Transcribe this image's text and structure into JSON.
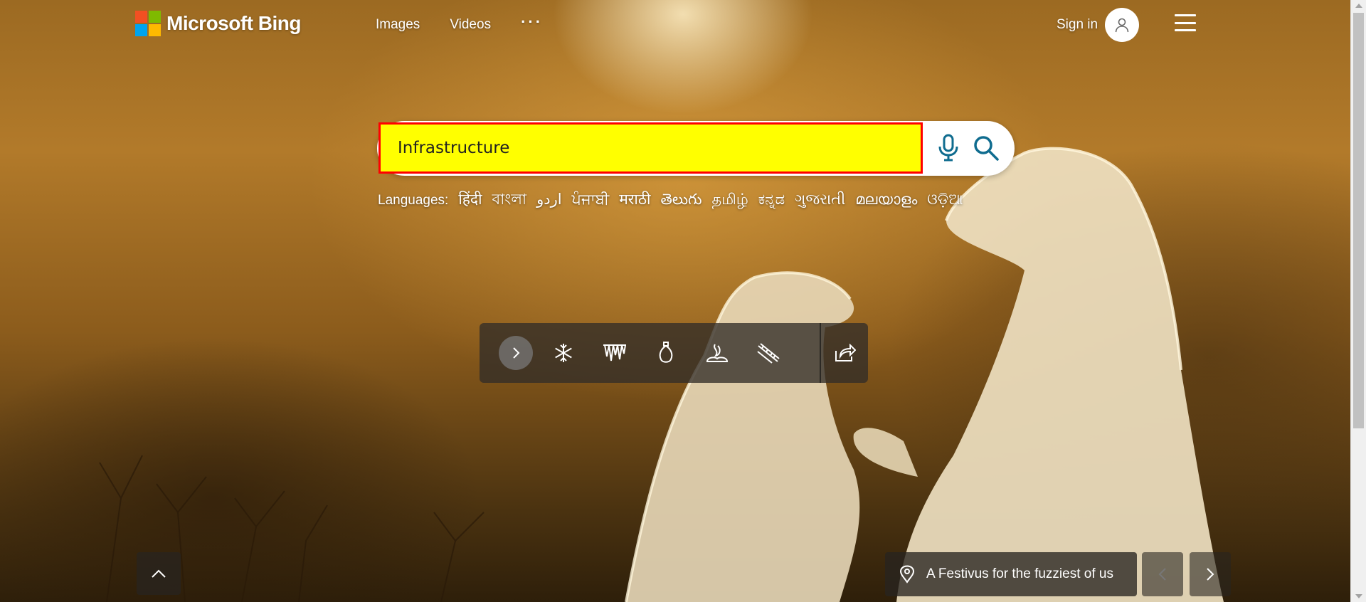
{
  "header": {
    "brand": "Microsoft Bing",
    "nav": [
      "Images",
      "Videos"
    ],
    "more_label": "···",
    "signin_label": "Sign in"
  },
  "search": {
    "value": "Infrastructure",
    "placeholder": ""
  },
  "languages": {
    "label": "Languages:",
    "items": [
      "हिंदी",
      "বাংলা",
      "اردو",
      "ਪੰਜਾਬੀ",
      "मराठी",
      "తెలుగు",
      "தமிழ்",
      "ಕನ್ನಡ",
      "ગુજરાતી",
      "മലയാളം",
      "ଓଡ଼ିଆ"
    ]
  },
  "toolbar": {
    "icons": [
      "chevron-right-icon",
      "snowflake-icon",
      "icicles-icon",
      "ornament-icon",
      "campfire-icon",
      "garland-icon",
      "share-icon"
    ]
  },
  "caption": {
    "text": "A Festivus for the fuzziest of us"
  },
  "colors": {
    "search_highlight": "#ffff00",
    "search_border": "#ff0000",
    "accent": "#0f6c8f"
  }
}
